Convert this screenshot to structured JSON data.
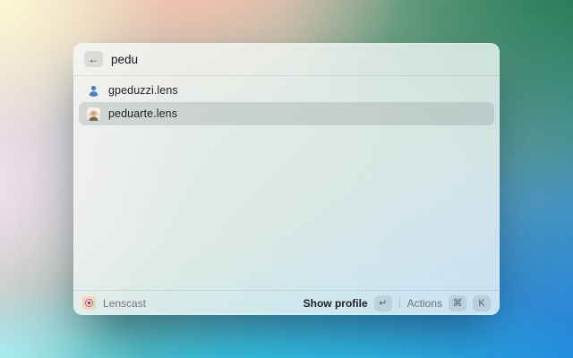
{
  "search": {
    "value": "pedu",
    "back_icon": "←"
  },
  "results": [
    {
      "label": "gpeduzzi.lens",
      "icon": "person-silhouette-blue",
      "selected": false
    },
    {
      "label": "peduarte.lens",
      "icon": "profile-photo-avatar",
      "selected": true
    }
  ],
  "footer": {
    "app_name": "Lenscast",
    "show_profile_label": "Show profile",
    "show_profile_key": "↵",
    "actions_label": "Actions",
    "actions_keys": [
      "⌘",
      "K"
    ]
  },
  "colors": {
    "selection_highlight": "#cdd2d0",
    "person_icon_blue": "#4d82b8",
    "logo_gradient": [
      "#f7c3d6",
      "#f3d9b2",
      "#b9e5c0"
    ],
    "logo_ring": "#cb539f",
    "background_mesh": [
      "#fdf7cf",
      "#f6bba6",
      "#f3dff1",
      "#9ef2f6",
      "#17c4ee",
      "#1b7fdc",
      "#156f47"
    ]
  }
}
